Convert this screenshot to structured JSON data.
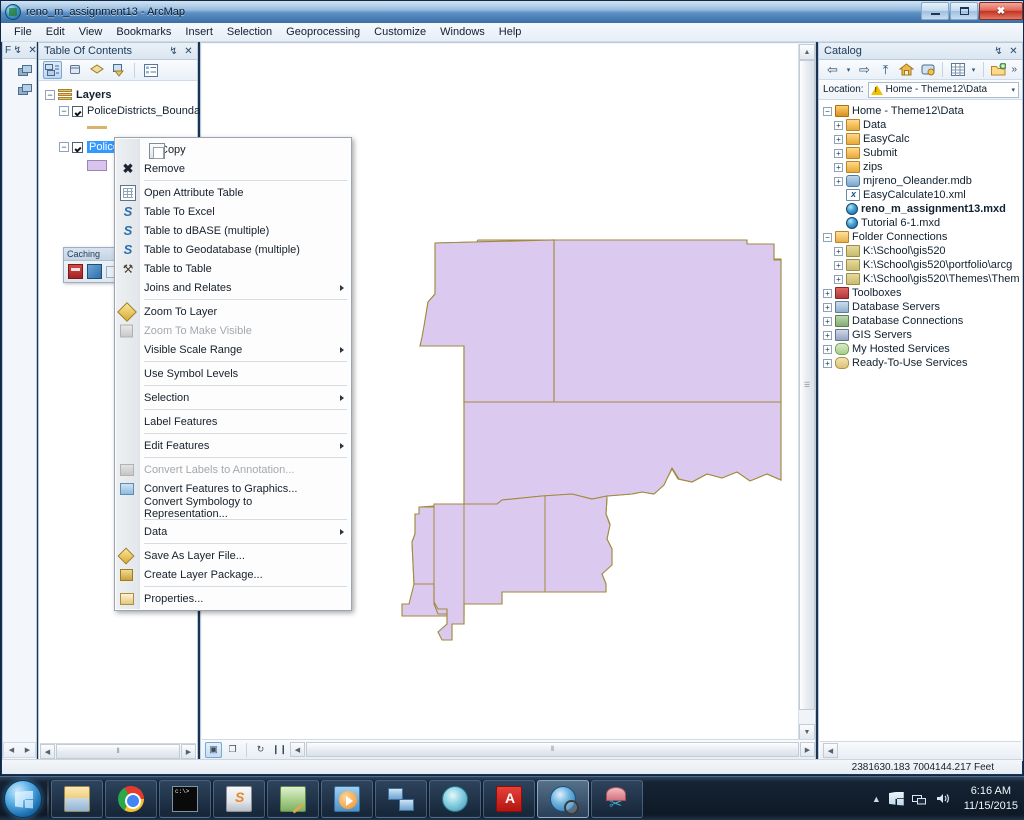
{
  "window": {
    "title": "reno_m_assignment13 - ArcMap",
    "app_icon": "arcmap-icon",
    "minimize_label": "Minimize",
    "maximize_label": "Maximize",
    "close_label": "✖"
  },
  "menubar": {
    "items": [
      {
        "label": "File"
      },
      {
        "label": "Edit"
      },
      {
        "label": "View"
      },
      {
        "label": "Bookmarks"
      },
      {
        "label": "Insert"
      },
      {
        "label": "Selection"
      },
      {
        "label": "Geoprocessing"
      },
      {
        "label": "Customize"
      },
      {
        "label": "Windows"
      },
      {
        "label": "Help"
      }
    ]
  },
  "autohide_strip": {
    "caption": "F",
    "pin_glyph": "↯",
    "close_glyph": "✕"
  },
  "toc": {
    "caption": "Table Of Contents",
    "pin_glyph": "↯",
    "close_glyph": "✕",
    "toolbar": [
      {
        "name": "list-by-drawing-order",
        "active": true
      },
      {
        "name": "list-by-source",
        "active": false
      },
      {
        "name": "list-by-visibility",
        "active": false
      },
      {
        "name": "list-by-selection",
        "active": false
      },
      {
        "name": "options",
        "active": false
      }
    ],
    "tree": {
      "root_label": "Layers",
      "layers": [
        {
          "label": "PoliceDistricts_Boundar",
          "checked": true,
          "symbol": "line",
          "symbol_color": "#d8b36a",
          "selected": false
        },
        {
          "label": "Police Districts",
          "checked": true,
          "symbol": "polygon",
          "symbol_color": "#d9c4ee",
          "selected": true
        }
      ]
    }
  },
  "caching_toolbar": {
    "title": "Caching",
    "buttons": [
      {
        "name": "cache-database-icon"
      },
      {
        "name": "cache-wand-icon"
      },
      {
        "name": "cache-extra-icon"
      }
    ]
  },
  "context_menu": {
    "items": [
      {
        "label": "Copy",
        "icon": "copy-icon",
        "disabled": false,
        "submenu": false,
        "separator_after": false
      },
      {
        "label": "Remove",
        "icon": "remove-icon",
        "disabled": false,
        "submenu": false,
        "separator_after": true
      },
      {
        "label": "Open Attribute Table",
        "icon": "table-icon",
        "disabled": false,
        "submenu": false,
        "separator_after": false
      },
      {
        "label": "Table To Excel",
        "icon": "script-icon",
        "disabled": false,
        "submenu": false,
        "separator_after": false
      },
      {
        "label": "Table to dBASE (multiple)",
        "icon": "script-icon",
        "disabled": false,
        "submenu": false,
        "separator_after": false
      },
      {
        "label": "Table to Geodatabase (multiple)",
        "icon": "script-icon",
        "disabled": false,
        "submenu": false,
        "separator_after": false
      },
      {
        "label": "Table to Table",
        "icon": "hammer-icon",
        "disabled": false,
        "submenu": false,
        "separator_after": false
      },
      {
        "label": "Joins and Relates",
        "icon": "none",
        "disabled": false,
        "submenu": true,
        "separator_after": true
      },
      {
        "label": "Zoom To Layer",
        "icon": "zoom-to-layer-icon",
        "disabled": false,
        "submenu": false,
        "separator_after": false
      },
      {
        "label": "Zoom To Make Visible",
        "icon": "zoom-make-visible-icon",
        "disabled": true,
        "submenu": false,
        "separator_after": false
      },
      {
        "label": "Visible Scale Range",
        "icon": "none",
        "disabled": false,
        "submenu": true,
        "separator_after": true
      },
      {
        "label": "Use Symbol Levels",
        "icon": "none",
        "disabled": false,
        "submenu": false,
        "separator_after": true
      },
      {
        "label": "Selection",
        "icon": "none",
        "disabled": false,
        "submenu": true,
        "separator_after": true
      },
      {
        "label": "Label Features",
        "icon": "none",
        "disabled": false,
        "submenu": false,
        "separator_after": true
      },
      {
        "label": "Edit Features",
        "icon": "none",
        "disabled": false,
        "submenu": true,
        "separator_after": true
      },
      {
        "label": "Convert Labels to Annotation...",
        "icon": "convert-labels-icon",
        "disabled": true,
        "submenu": false,
        "separator_after": false
      },
      {
        "label": "Convert Features to Graphics...",
        "icon": "convert-features-icon",
        "disabled": false,
        "submenu": false,
        "separator_after": false
      },
      {
        "label": "Convert Symbology to Representation...",
        "icon": "none",
        "disabled": false,
        "submenu": false,
        "separator_after": true
      },
      {
        "label": "Data",
        "icon": "none",
        "disabled": false,
        "submenu": true,
        "separator_after": true
      },
      {
        "label": "Save As Layer File...",
        "icon": "layer-file-icon",
        "disabled": false,
        "submenu": false,
        "separator_after": false
      },
      {
        "label": "Create Layer Package...",
        "icon": "layer-package-icon",
        "disabled": false,
        "submenu": false,
        "separator_after": true
      },
      {
        "label": "Properties...",
        "icon": "properties-icon",
        "disabled": false,
        "submenu": false,
        "separator_after": false
      }
    ]
  },
  "map": {
    "fill_color": "#dcc9f0",
    "stroke_color": "#a08a3c",
    "background": "#ffffff",
    "bottom_toolbar": [
      {
        "name": "data-view-button",
        "glyph": "▣",
        "active": true
      },
      {
        "name": "layout-view-button",
        "glyph": "❐",
        "active": false
      },
      {
        "name": "refresh-button",
        "glyph": "↻",
        "active": false
      },
      {
        "name": "pause-drawing-button",
        "glyph": "❙❙",
        "active": false
      }
    ],
    "scroll_left_glyph": "◀",
    "scroll_right_glyph": "▶",
    "scroll_up_glyph": "▲",
    "scroll_down_glyph": "▼",
    "grip": "⦀"
  },
  "catalog": {
    "caption": "Catalog",
    "pin_glyph": "↯",
    "close_glyph": "✕",
    "toolbar": [
      {
        "name": "back-button",
        "glyph": "⇦"
      },
      {
        "name": "back-dropdown",
        "glyph": "▾"
      },
      {
        "name": "forward-button",
        "glyph": "⇨"
      },
      {
        "name": "up-one-level-button",
        "glyph": "⤒"
      },
      {
        "name": "home-button",
        "glyph": "⌂"
      },
      {
        "name": "default-geodatabase-button",
        "glyph": "▤"
      },
      {
        "name": "toggle-contents-panel-button",
        "glyph": "▦"
      },
      {
        "name": "contents-dropdown",
        "glyph": "▾"
      },
      {
        "name": "connect-to-folder-button",
        "glyph": "⊞"
      },
      {
        "name": "overflow-button",
        "glyph": "»"
      }
    ],
    "location": {
      "label": "Location:",
      "value": "Home - Theme12\\Data",
      "warning_icon": "warning-icon",
      "dropdown_glyph": "▾"
    },
    "tree": [
      {
        "label": "Home - Theme12\\Data",
        "indent": 0,
        "expander": "-",
        "icon": "folder-home",
        "bold": false
      },
      {
        "label": "Data",
        "indent": 1,
        "expander": "+",
        "icon": "folder",
        "bold": false
      },
      {
        "label": "EasyCalc",
        "indent": 1,
        "expander": "+",
        "icon": "folder",
        "bold": false
      },
      {
        "label": "Submit",
        "indent": 1,
        "expander": "+",
        "icon": "folder",
        "bold": false
      },
      {
        "label": "zips",
        "indent": 1,
        "expander": "+",
        "icon": "folder",
        "bold": false
      },
      {
        "label": "mjreno_Oleander.mdb",
        "indent": 1,
        "expander": "+",
        "icon": "mdb",
        "bold": false
      },
      {
        "label": "EasyCalculate10.xml",
        "indent": 1,
        "expander": "",
        "icon": "xml",
        "bold": false
      },
      {
        "label": "reno_m_assignment13.mxd",
        "indent": 1,
        "expander": "",
        "icon": "mxd",
        "bold": true
      },
      {
        "label": "Tutorial 6-1.mxd",
        "indent": 1,
        "expander": "",
        "icon": "mxd",
        "bold": false
      },
      {
        "label": "Folder Connections",
        "indent": 0,
        "expander": "-",
        "icon": "folder-conn",
        "bold": false
      },
      {
        "label": "K:\\School\\gis520",
        "indent": 1,
        "expander": "+",
        "icon": "folder-green",
        "bold": false
      },
      {
        "label": "K:\\School\\gis520\\portfolio\\arcg",
        "indent": 1,
        "expander": "+",
        "icon": "folder-green",
        "bold": false
      },
      {
        "label": "K:\\School\\gis520\\Themes\\Them",
        "indent": 1,
        "expander": "+",
        "icon": "folder-green",
        "bold": false
      },
      {
        "label": "Toolboxes",
        "indent": 0,
        "expander": "+",
        "icon": "toolbox",
        "bold": false
      },
      {
        "label": "Database Servers",
        "indent": 0,
        "expander": "+",
        "icon": "dbserver",
        "bold": false
      },
      {
        "label": "Database Connections",
        "indent": 0,
        "expander": "+",
        "icon": "dbconn",
        "bold": false
      },
      {
        "label": "GIS Servers",
        "indent": 0,
        "expander": "+",
        "icon": "gisserver",
        "bold": false
      },
      {
        "label": "My Hosted Services",
        "indent": 0,
        "expander": "+",
        "icon": "cloud",
        "bold": false
      },
      {
        "label": "Ready-To-Use Services",
        "indent": 0,
        "expander": "+",
        "icon": "cloud2",
        "bold": false
      }
    ]
  },
  "statusbar": {
    "coordinates": "2381630.183  7004144.217 Feet"
  },
  "taskbar": {
    "start_label": "Start",
    "apps": [
      {
        "name": "windows-explorer",
        "icon": "explorer-icon",
        "running": false
      },
      {
        "name": "google-chrome",
        "icon": "chrome-icon",
        "running": false
      },
      {
        "name": "command-prompt",
        "icon": "cmd-icon",
        "running": false
      },
      {
        "name": "sublime-text",
        "icon": "sublime-icon",
        "running": false
      },
      {
        "name": "arcmap-2",
        "icon": "arcmap-alt-icon",
        "running": false
      },
      {
        "name": "media-player",
        "icon": "media-player-icon",
        "running": false
      },
      {
        "name": "network-connections",
        "icon": "network-icon",
        "running": false
      },
      {
        "name": "brain-app",
        "icon": "brain-icon",
        "running": false
      },
      {
        "name": "adobe-acrobat",
        "icon": "acrobat-icon",
        "running": false
      },
      {
        "name": "arcmap-active",
        "icon": "arcglobe-icon",
        "running": true
      },
      {
        "name": "snipping-tool",
        "icon": "snip-icon",
        "running": false
      }
    ],
    "tray": {
      "chevron": "▲",
      "network_icon": "network-tray-icon",
      "volume_icon": "🔊",
      "time": "6:16 AM",
      "date": "11/15/2015"
    }
  }
}
